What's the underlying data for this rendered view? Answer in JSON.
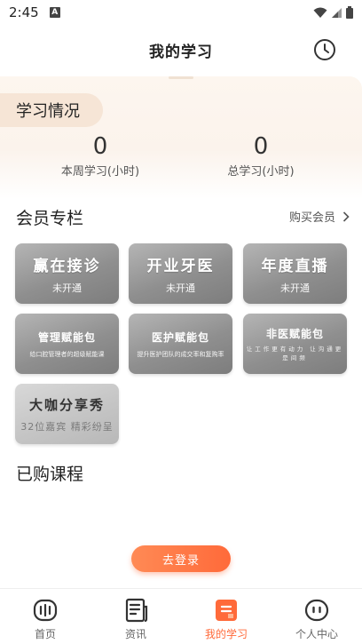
{
  "status_bar": {
    "time": "2:45",
    "notification_letter": "A"
  },
  "header": {
    "title": "我的学习",
    "history_icon": "clock-icon"
  },
  "study": {
    "tag": "学习情况",
    "weekly_value": "0",
    "weekly_label": "本周学习(小时)",
    "total_value": "0",
    "total_label": "总学习(小时)"
  },
  "member": {
    "title": "会员专栏",
    "buy_label": "购买会员",
    "cards": [
      {
        "title": "赢在接诊",
        "sub": "未开通"
      },
      {
        "title": "开业牙医",
        "sub": "未开通"
      },
      {
        "title": "年度直播",
        "sub": "未开通"
      },
      {
        "title": "管理赋能包",
        "sub": "给口腔管理者的超级赋能课"
      },
      {
        "title": "医护赋能包",
        "sub": "提升医护团队的成交率和复购率"
      },
      {
        "title": "非医赋能包",
        "sub": "让工作更有动力 让沟通更是间频"
      },
      {
        "title": "大咖分享秀",
        "sub": "32位嘉宾 精彩纷呈"
      }
    ]
  },
  "purchased": {
    "title": "已购课程"
  },
  "login_button": "去登录",
  "nav": {
    "items": [
      {
        "label": "首页",
        "icon": "home-icon"
      },
      {
        "label": "资讯",
        "icon": "news-icon"
      },
      {
        "label": "我的学习",
        "icon": "study-icon"
      },
      {
        "label": "个人中心",
        "icon": "profile-icon"
      }
    ],
    "active_color": "#ff6a3a"
  },
  "colors": {
    "accent": "#ff6a3a",
    "card_gray": "#8f8f8f",
    "summary_bg": "#fdf6ef"
  }
}
